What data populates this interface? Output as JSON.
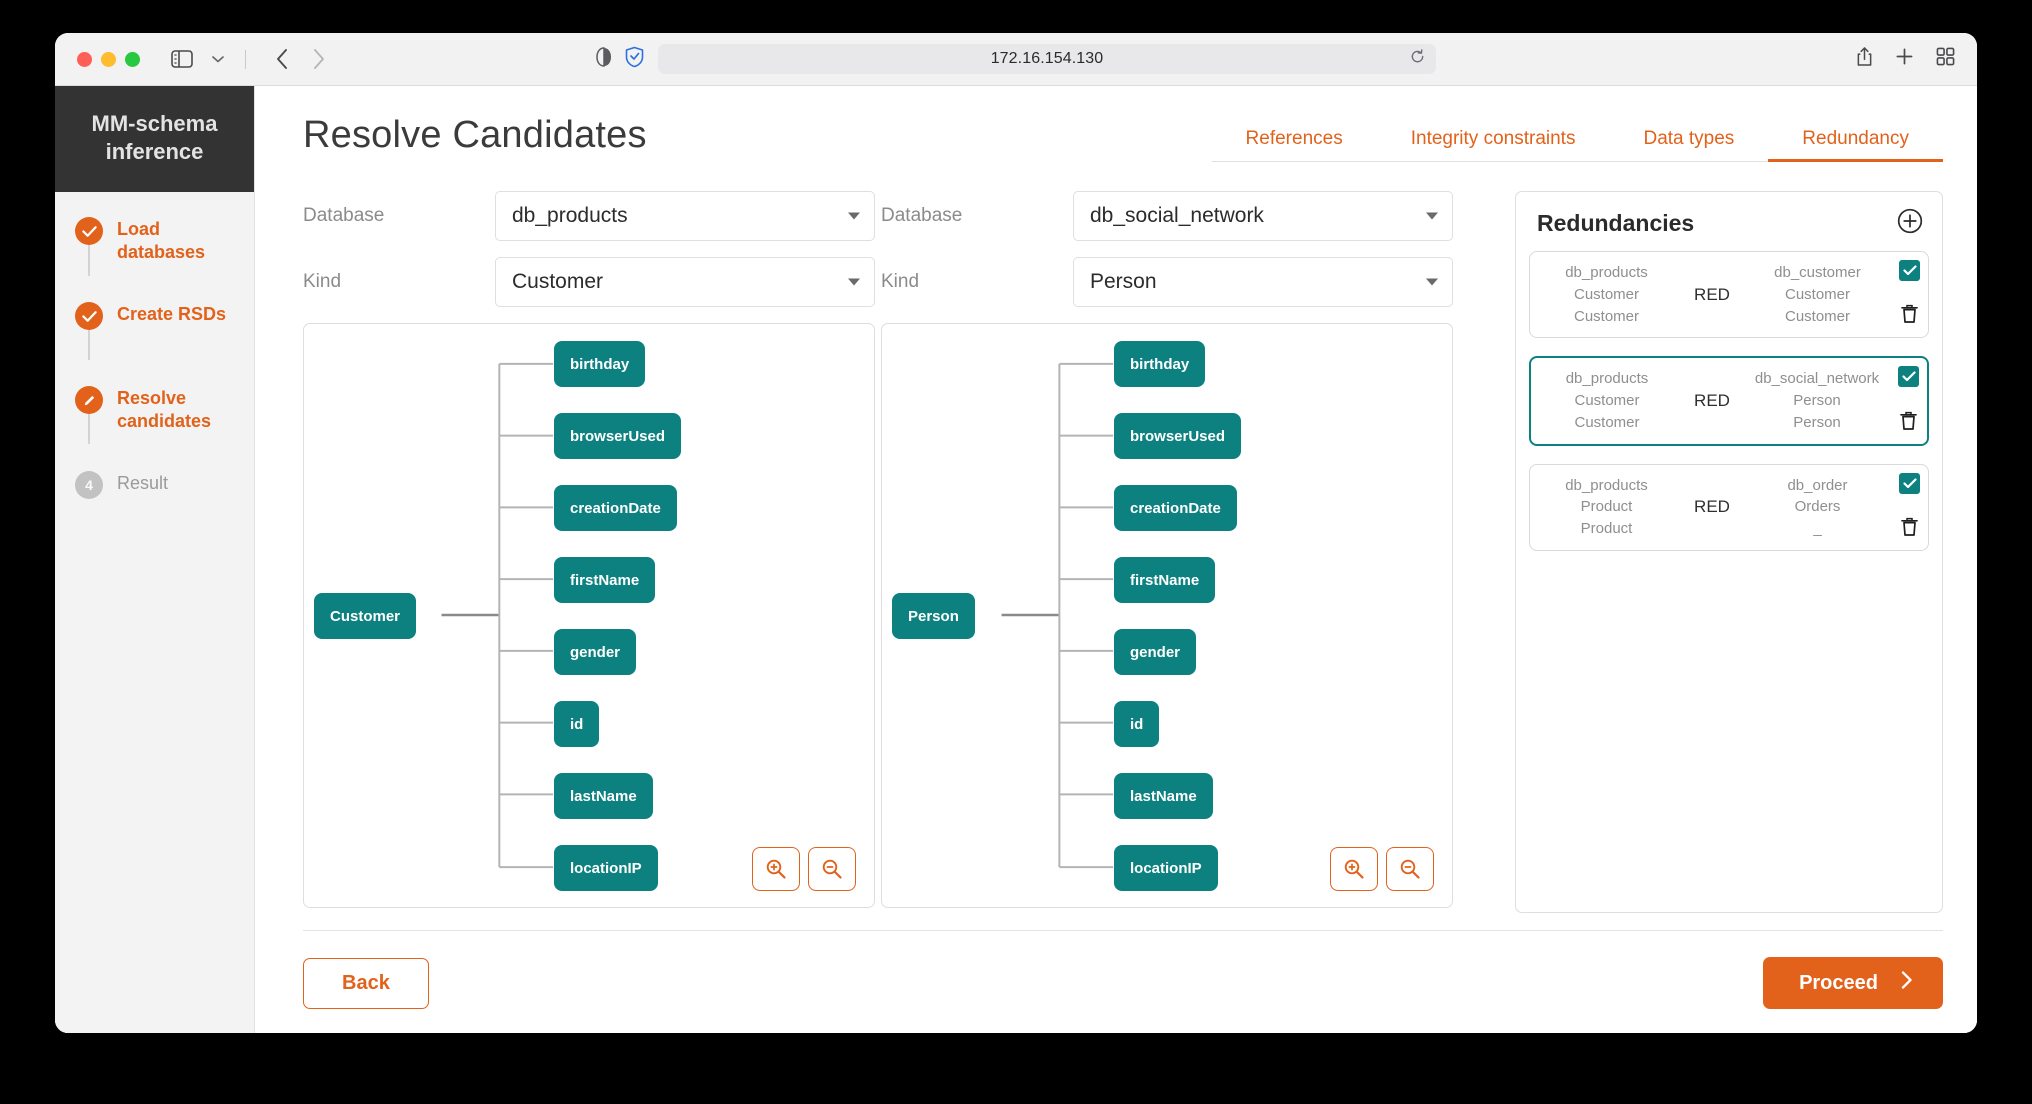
{
  "browser": {
    "url": "172.16.154.130",
    "icons": {
      "sidebar_toggle": "sidebar-toggle-icon",
      "tab_group_chevron": "chevron-down-icon",
      "back": "back-arrow-icon",
      "forward": "forward-arrow-icon",
      "reader": "reader-mode-icon",
      "privacy_shield": "shield-check-icon",
      "reload": "reload-icon",
      "share": "share-icon",
      "new_tab": "plus-icon",
      "tab_overview": "tab-overview-icon"
    }
  },
  "sidebar": {
    "brand_line1": "MM-schema",
    "brand_line2": "inference",
    "steps": [
      {
        "label": "Load databases",
        "state": "done",
        "marker": "check-icon"
      },
      {
        "label": "Create RSDs",
        "state": "done",
        "marker": "check-icon"
      },
      {
        "label": "Resolve candidates",
        "state": "active",
        "marker": "pencil-icon"
      },
      {
        "label": "Result",
        "state": "todo",
        "marker": "4"
      }
    ]
  },
  "header": {
    "title": "Resolve Candidates"
  },
  "tabs": [
    {
      "label": "References",
      "active": false
    },
    {
      "label": "Integrity constraints",
      "active": false
    },
    {
      "label": "Data types",
      "active": false
    },
    {
      "label": "Redundancy",
      "active": true
    }
  ],
  "panes": [
    {
      "database_label": "Database",
      "database_value": "db_products",
      "kind_label": "Kind",
      "kind_value": "Customer",
      "graph": {
        "root": "Customer",
        "properties": [
          "birthday",
          "browserUsed",
          "creationDate",
          "firstName",
          "gender",
          "id",
          "lastName",
          "locationIP"
        ]
      },
      "zoom_in_label": "zoom-in",
      "zoom_out_label": "zoom-out"
    },
    {
      "database_label": "Database",
      "database_value": "db_social_network",
      "kind_label": "Kind",
      "kind_value": "Person",
      "graph": {
        "root": "Person",
        "properties": [
          "birthday",
          "browserUsed",
          "creationDate",
          "firstName",
          "gender",
          "id",
          "lastName",
          "locationIP"
        ]
      },
      "zoom_in_label": "zoom-in",
      "zoom_out_label": "zoom-out"
    }
  ],
  "redundancies": {
    "title": "Redundancies",
    "add_label": "add-redundancy",
    "items": [
      {
        "left": [
          "db_products",
          "Customer",
          "Customer"
        ],
        "middle": "RED",
        "right": [
          "db_customer",
          "Customer",
          "Customer"
        ],
        "checked": true,
        "selected": false
      },
      {
        "left": [
          "db_products",
          "Customer",
          "Customer"
        ],
        "middle": "RED",
        "right": [
          "db_social_network",
          "Person",
          "Person"
        ],
        "checked": true,
        "selected": true
      },
      {
        "left": [
          "db_products",
          "Product",
          "Product"
        ],
        "middle": "RED",
        "right": [
          "db_order",
          "Orders",
          "_"
        ],
        "checked": true,
        "selected": false
      }
    ]
  },
  "footer": {
    "back_label": "Back",
    "proceed_label": "Proceed",
    "proceed_icon": "chevron-right-icon"
  },
  "colors": {
    "accent": "#e2621b",
    "node": "#0d8080",
    "brand_bg": "#333333"
  }
}
